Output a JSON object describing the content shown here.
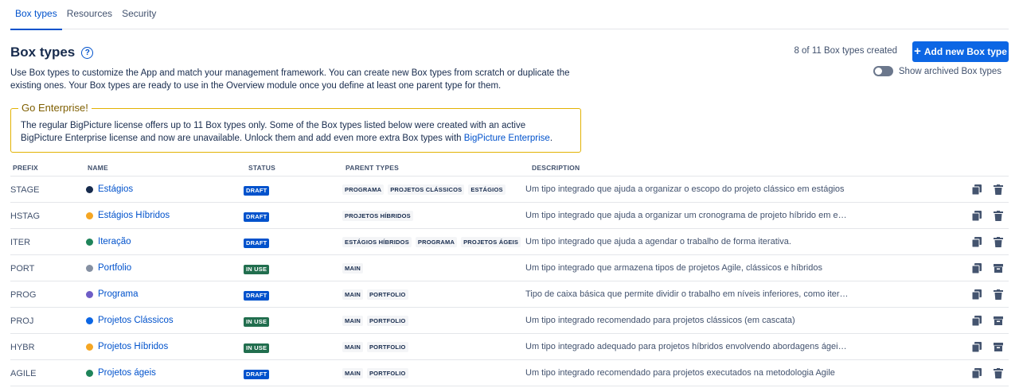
{
  "tabs": [
    {
      "label": "Box types",
      "active": true
    },
    {
      "label": "Resources",
      "active": false
    },
    {
      "label": "Security",
      "active": false
    }
  ],
  "header": {
    "title": "Box types",
    "help_icon": "?",
    "description": "Use Box types to customize the App and match your management framework. You can create new Box types from scratch or duplicate the existing ones. Your Box types are ready to use in the Overview module once you define at least one parent type for them.",
    "count_text": "8 of 11 Box types created",
    "add_button_label": "Add new Box type",
    "archived_toggle_label": "Show archived Box types"
  },
  "enterprise_notice": {
    "title": "Go Enterprise!",
    "text_before_link": "The regular BigPicture license offers up to 11 Box types only. Some of the Box types listed below were created with an active BigPicture Enterprise license and now are unavailable. Unlock them and add even more extra Box types with ",
    "link_text": "BigPicture Enterprise",
    "text_after_link": "."
  },
  "table": {
    "columns": [
      "PREFIX",
      "NAME",
      "STATUS",
      "PARENT TYPES",
      "DESCRIPTION"
    ],
    "rows": [
      {
        "prefix": "STAGE",
        "name": "Estágios",
        "color": "#172b4d",
        "status": "DRAFT",
        "parents": [
          "PROGRAMA",
          "PROJETOS CLÁSSICOS",
          "ESTÁGIOS"
        ],
        "description": "Um tipo integrado que ajuda a organizar o escopo do projeto clássico em estágios",
        "second_action": "trash-icon"
      },
      {
        "prefix": "HSTAG",
        "name": "Estágios Híbridos",
        "color": "#f5a623",
        "status": "DRAFT",
        "parents": [
          "PROJETOS HÍBRIDOS"
        ],
        "description": "Um tipo integrado que ajuda a organizar um cronograma de projeto híbrido em e…",
        "second_action": "trash-icon"
      },
      {
        "prefix": "ITER",
        "name": "Iteração",
        "color": "#1f845a",
        "status": "DRAFT",
        "parents": [
          "ESTÁGIOS HÍBRIDOS",
          "PROGRAMA",
          "PROJETOS ÁGEIS"
        ],
        "description": "Um tipo integrado que ajuda a agendar o trabalho de forma iterativa.",
        "second_action": "trash-icon"
      },
      {
        "prefix": "PORT",
        "name": "Portfolio",
        "color": "#8590a2",
        "status": "IN USE",
        "parents": [
          "MAIN"
        ],
        "description": "Um tipo integrado que armazena tipos de projetos Agile, clássicos e híbridos",
        "second_action": "archive-icon"
      },
      {
        "prefix": "PROG",
        "name": "Programa",
        "color": "#6e5dc6",
        "status": "DRAFT",
        "parents": [
          "MAIN",
          "PORTFOLIO"
        ],
        "description": "Tipo de caixa básica que permite dividir o trabalho em níveis inferiores, como iter…",
        "second_action": "trash-icon"
      },
      {
        "prefix": "PROJ",
        "name": "Projetos Clássicos",
        "color": "#0c66e4",
        "status": "IN USE",
        "parents": [
          "MAIN",
          "PORTFOLIO"
        ],
        "description": "Um tipo integrado recomendado para projetos clássicos (em cascata)",
        "second_action": "archive-icon"
      },
      {
        "prefix": "HYBR",
        "name": "Projetos Híbridos",
        "color": "#f5a623",
        "status": "IN USE",
        "parents": [
          "MAIN",
          "PORTFOLIO"
        ],
        "description": "Um tipo integrado adequado para projetos híbridos envolvendo abordagens ágei…",
        "second_action": "archive-icon"
      },
      {
        "prefix": "AGILE",
        "name": "Projetos ágeis",
        "color": "#1f845a",
        "status": "DRAFT",
        "parents": [
          "MAIN",
          "PORTFOLIO"
        ],
        "description": "Um tipo integrado recomendado para projetos executados na metodologia Agile",
        "second_action": "trash-icon"
      }
    ]
  },
  "colors": {
    "accent": "#0c66e4",
    "draft": "#0052cc",
    "in_use": "#216e4e",
    "enterprise_border": "#e2b203"
  }
}
